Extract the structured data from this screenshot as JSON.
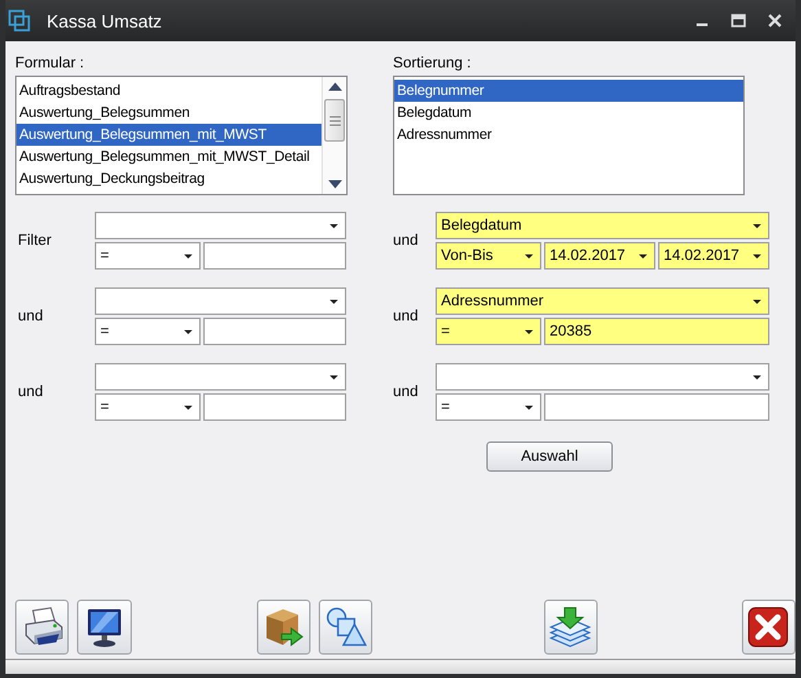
{
  "window": {
    "title": "Kassa Umsatz"
  },
  "formular": {
    "label": "Formular :",
    "items": [
      {
        "text": "Auftragsbestand",
        "selected": false
      },
      {
        "text": "Auswertung_Belegsummen",
        "selected": false
      },
      {
        "text": "Auswertung_Belegsummen_mit_MWST",
        "selected": true
      },
      {
        "text": "Auswertung_Belegsummen_mit_MWST_Detail",
        "selected": false
      },
      {
        "text": "Auswertung_Deckungsbeitrag",
        "selected": false
      }
    ]
  },
  "sortierung": {
    "label": "Sortierung :",
    "items": [
      {
        "text": "Belegnummer",
        "selected": true
      },
      {
        "text": "Belegdatum",
        "selected": false
      },
      {
        "text": "Adressnummer",
        "selected": false
      }
    ]
  },
  "filters_left": [
    {
      "kind": "single",
      "connector": "Filter",
      "operator": "=",
      "highlighted": false
    },
    {
      "kind": "single",
      "connector": "und",
      "operator": "=",
      "highlighted": false
    },
    {
      "kind": "single",
      "connector": "und",
      "operator": "=",
      "highlighted": false
    }
  ],
  "filters_right": [
    {
      "kind": "range",
      "connector": "und",
      "field": "Belegdatum",
      "operator": "Von-Bis",
      "from": "14.02.2017",
      "to": "14.02.2017",
      "highlighted": true
    },
    {
      "kind": "single",
      "connector": "und",
      "field": "Adressnummer",
      "operator": "=",
      "value": "20385",
      "highlighted": true
    },
    {
      "kind": "single",
      "connector": "und",
      "operator": "=",
      "highlighted": false
    }
  ],
  "select_button": "Auswahl"
}
